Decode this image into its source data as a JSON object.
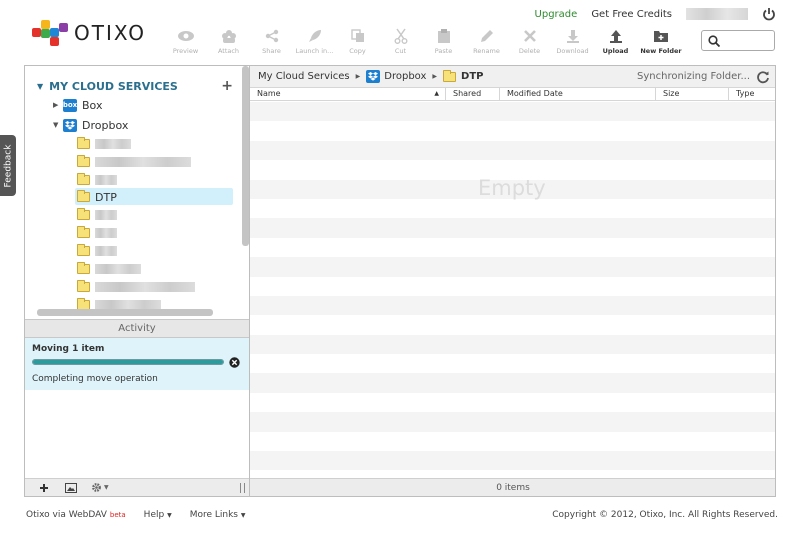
{
  "brand": {
    "name": "OTIXO",
    "colors": [
      "#e4322b",
      "#f7b51c",
      "#3daa4b",
      "#1e88d6",
      "#8b3fa6"
    ]
  },
  "top_links": {
    "upgrade": "Upgrade",
    "credits": "Get Free Credits"
  },
  "toolbar": [
    {
      "label": "Preview",
      "icon": "eye-icon",
      "enabled": false
    },
    {
      "label": "Attach",
      "icon": "people-icon",
      "enabled": false
    },
    {
      "label": "Share",
      "icon": "share-icon",
      "enabled": false
    },
    {
      "label": "Launch in...",
      "icon": "rocket-icon",
      "enabled": false
    },
    {
      "label": "Copy",
      "icon": "copy-icon",
      "enabled": false
    },
    {
      "label": "Cut",
      "icon": "scissors-icon",
      "enabled": false
    },
    {
      "label": "Paste",
      "icon": "clipboard-icon",
      "enabled": false
    },
    {
      "label": "Rename",
      "icon": "pencil-icon",
      "enabled": false
    },
    {
      "label": "Delete",
      "icon": "x-icon",
      "enabled": false
    },
    {
      "label": "Download",
      "icon": "download-icon",
      "enabled": false
    },
    {
      "label": "Upload",
      "icon": "upload-icon",
      "enabled": true
    },
    {
      "label": "New Folder",
      "icon": "new-folder-icon",
      "enabled": true
    }
  ],
  "tree": {
    "header": "MY CLOUD SERVICES",
    "services": [
      {
        "label": "Box",
        "icon": "box"
      },
      {
        "label": "Dropbox",
        "icon": "dropbox"
      }
    ],
    "selected_folder": "DTP"
  },
  "activity": {
    "header": "Activity",
    "title": "Moving 1 item",
    "progress": 1.0,
    "status": "Completing move operation"
  },
  "breadcrumb": {
    "root": "My Cloud Services",
    "service": "Dropbox",
    "current": "DTP",
    "sync": "Synchronizing Folder..."
  },
  "columns": [
    "Name",
    "Shared",
    "Modified Date",
    "Size",
    "Type"
  ],
  "file_list": {
    "empty_text": "Empty",
    "item_count": "0 items"
  },
  "feedback": "Feedback",
  "footer": {
    "app": "Otixo via WebDAV",
    "beta": "beta",
    "help": "Help",
    "more": "More Links",
    "copyright": "Copyright © 2012, Otixo, Inc. All Rights Reserved."
  }
}
